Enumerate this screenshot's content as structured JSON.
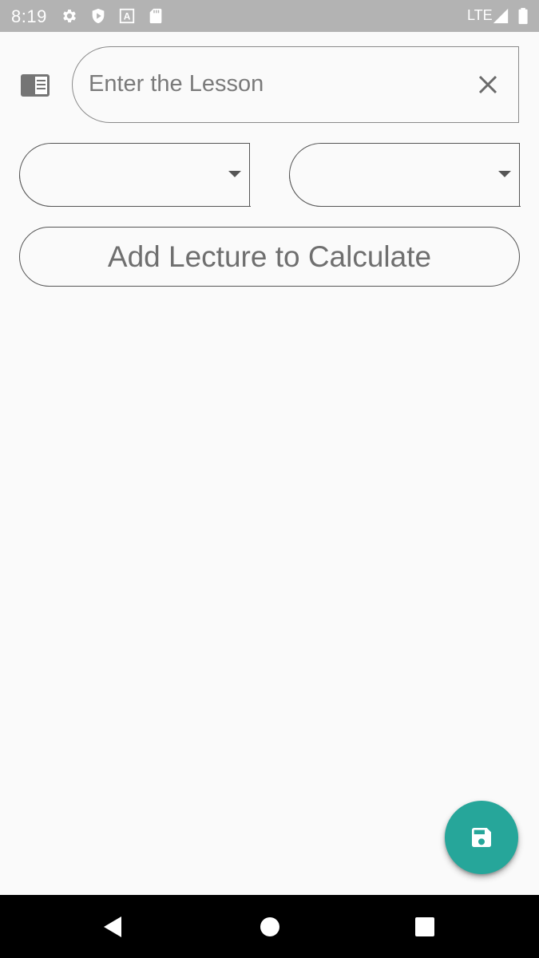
{
  "status_bar": {
    "time": "8:19",
    "network": "LTE",
    "icons": [
      "settings-icon",
      "play-protect-icon",
      "font-a-icon",
      "sd-card-icon",
      "signal-icon",
      "battery-icon"
    ]
  },
  "lesson": {
    "icon": "book-list-icon",
    "placeholder": "Enter the Lesson",
    "value": "",
    "clear_icon": "close-icon"
  },
  "dropdowns": [
    {
      "selected": ""
    },
    {
      "selected": ""
    }
  ],
  "add_lecture_button": {
    "label": "Add Lecture to Calculate"
  },
  "fab": {
    "icon": "save-icon",
    "color": "#26a69a"
  },
  "nav_bar": {
    "icons": [
      "back-icon",
      "home-icon",
      "recents-icon"
    ]
  }
}
